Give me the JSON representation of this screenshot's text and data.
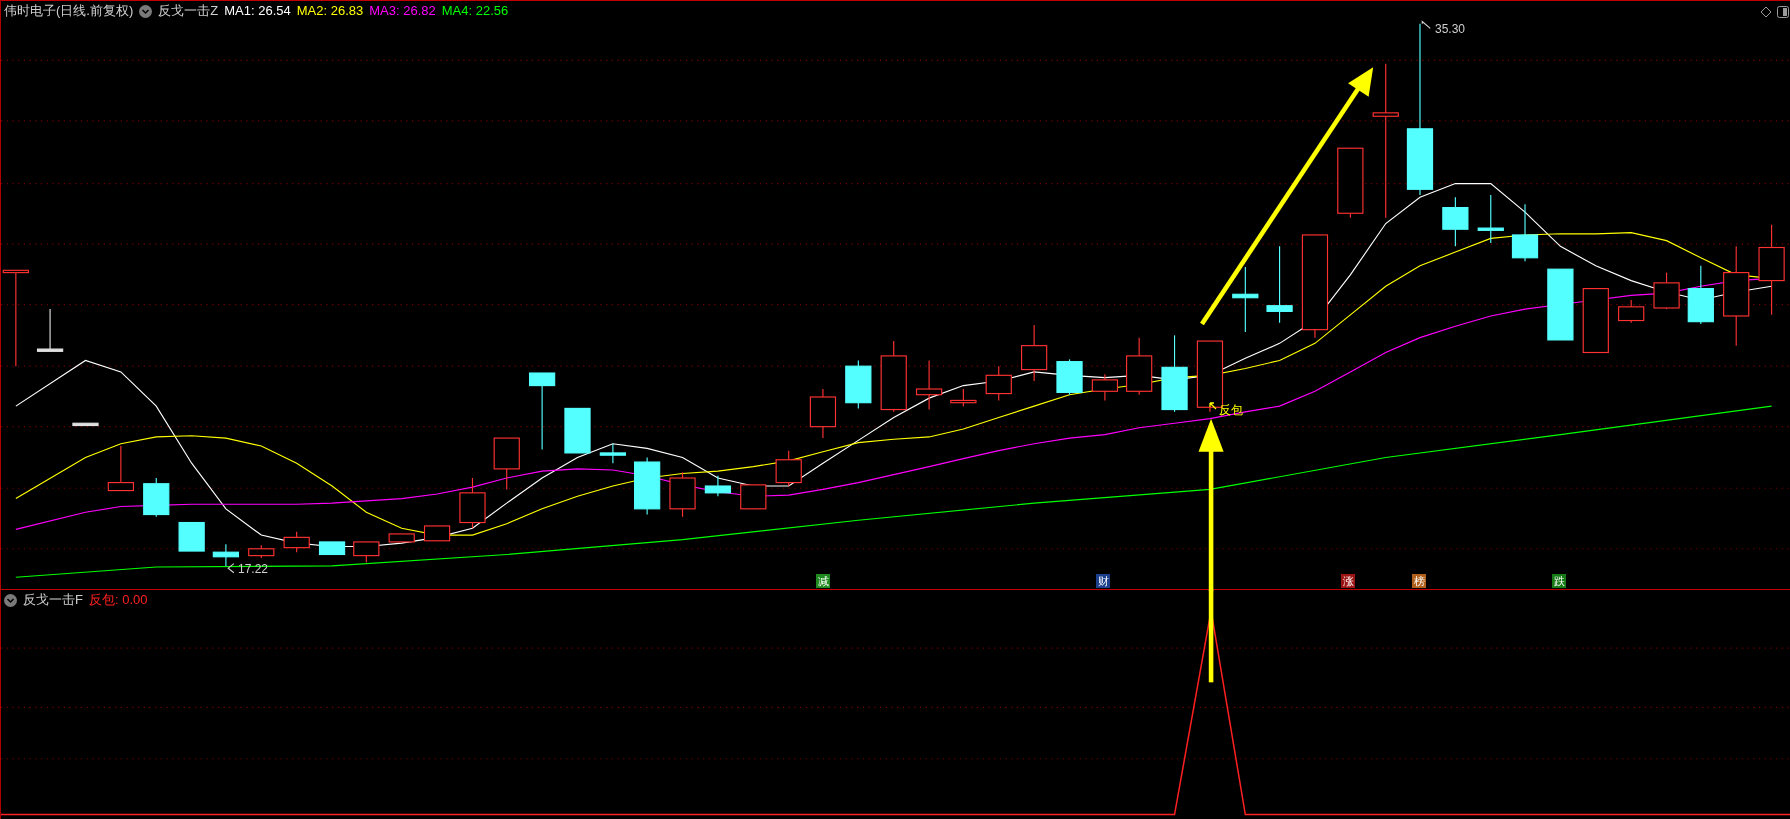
{
  "header": {
    "stock": "伟时电子(日线.前复权)",
    "indicator": "反戈一击Z",
    "ma": [
      {
        "label": "MA1: 26.54",
        "color": "#ffffff"
      },
      {
        "label": "MA2: 26.83",
        "color": "#ffff00"
      },
      {
        "label": "MA3: 26.82",
        "color": "#ff00ff"
      },
      {
        "label": "MA4: 22.56",
        "color": "#00ff00"
      }
    ]
  },
  "main_chart": {
    "high_label": "35.30",
    "low_label": "17.22",
    "signal_label": "反包",
    "markers": [
      {
        "text": "减",
        "color": "#1f8a1f"
      },
      {
        "text": "财",
        "color": "#1c3f8c"
      },
      {
        "text": "涨",
        "color": "#9c1414"
      },
      {
        "text": "榜",
        "color": "#b0601a"
      },
      {
        "text": "跌",
        "color": "#167a16"
      }
    ]
  },
  "sub_panel": {
    "indicator": "反戈一击F",
    "value": "反包: 0.00"
  }
}
